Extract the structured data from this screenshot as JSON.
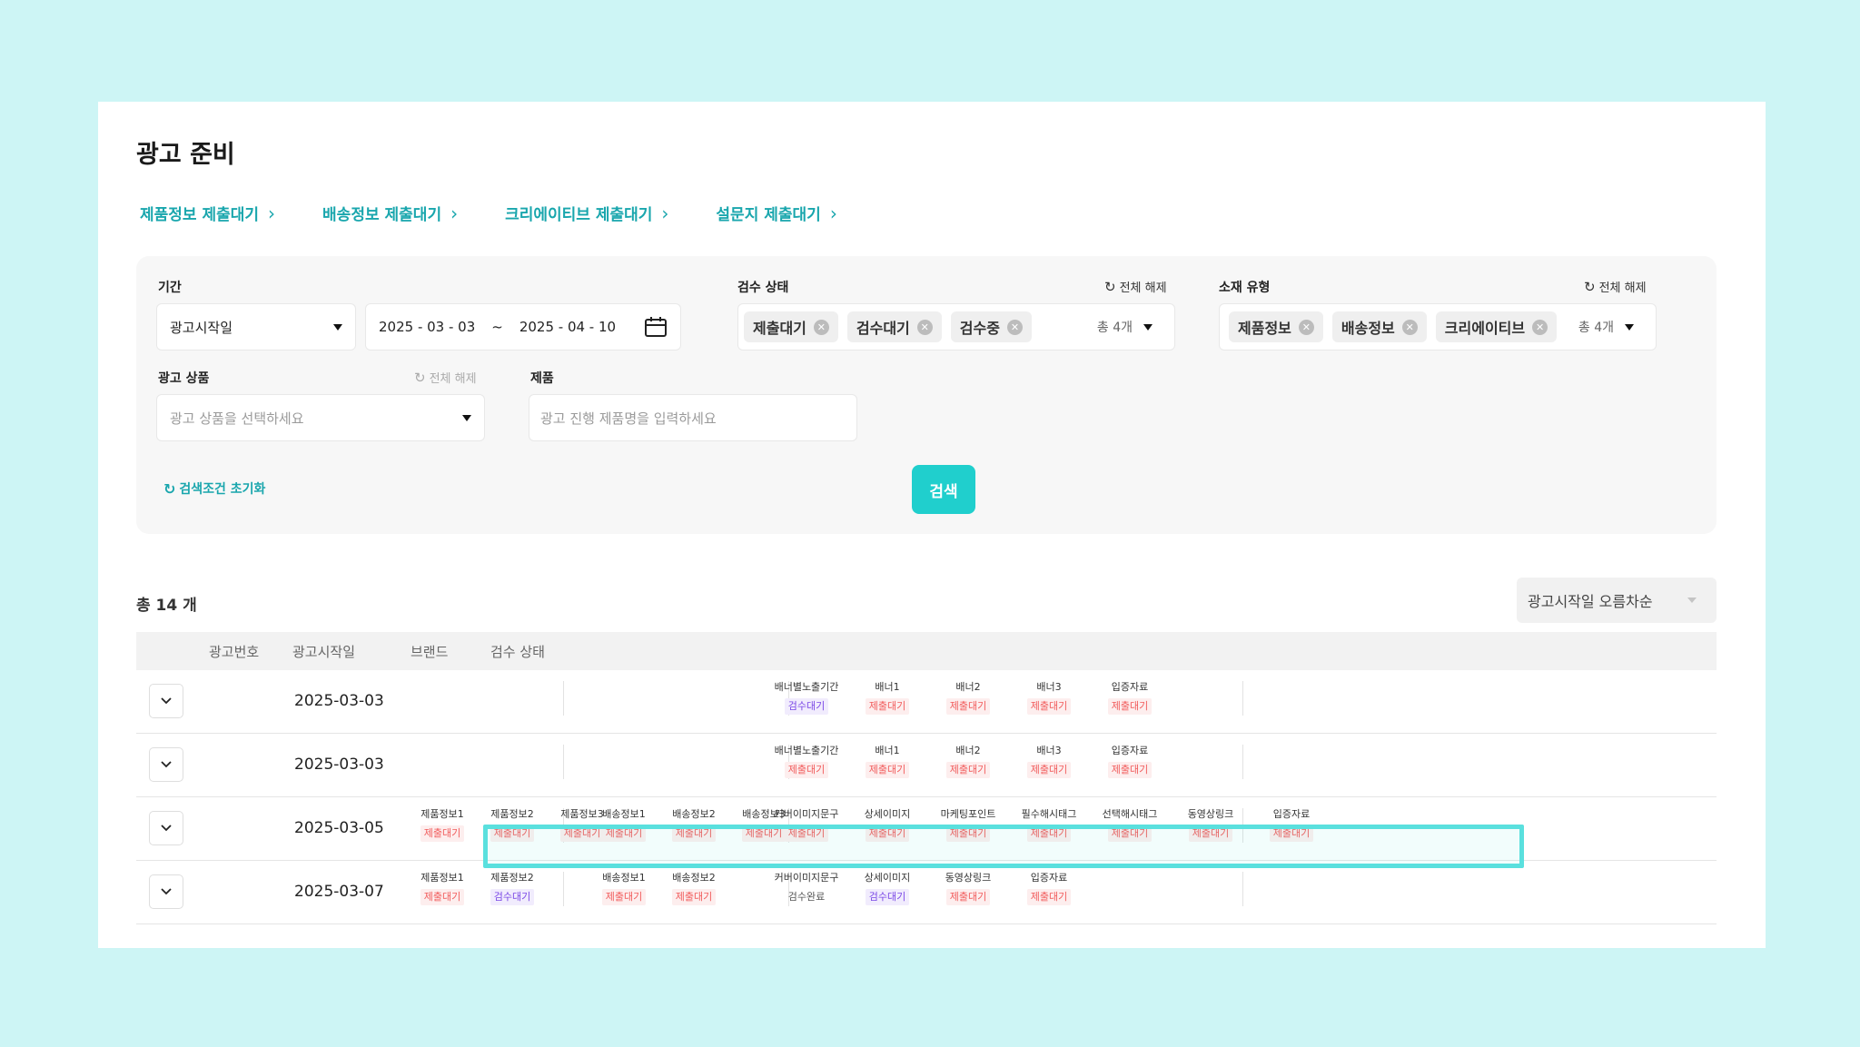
{
  "page": {
    "title": "광고 준비",
    "quick_links": [
      "제품정보 제출대기",
      "배송정보 제출대기",
      "크리에이티브 제출대기",
      "설문지 제출대기"
    ],
    "chevron": "›"
  },
  "filters": {
    "period": {
      "label": "기간",
      "type_value": "광고시작일",
      "start_date": "2025 - 03 - 03",
      "tilde": "~",
      "end_date": "2025 - 04 - 10"
    },
    "review_status": {
      "label": "검수 상태",
      "clear_label": "전체 해제",
      "chips": [
        "제출대기",
        "검수대기",
        "검수중"
      ],
      "count": "총 4개"
    },
    "material_type": {
      "label": "소재 유형",
      "clear_label": "전체 해제",
      "chips": [
        "제품정보",
        "배송정보",
        "크리에이티브"
      ],
      "count": "총 4개"
    },
    "ad_product": {
      "label": "광고 상품",
      "clear_label": "전체 해제",
      "placeholder": "광고 상품을 선택하세요"
    },
    "product": {
      "label": "제품",
      "placeholder": "광고 진행 제품명을 입력하세요"
    },
    "reset_label": "검색조건 초기화",
    "search_label": "검색"
  },
  "list": {
    "total": "총 14 개",
    "sort_value": "광고시작일 오름차순",
    "headers": [
      "광고번호",
      "광고시작일",
      "브랜드",
      "검수 상태"
    ],
    "rows": [
      {
        "date": "2025-03-03",
        "groups": [
          [],
          [],
          [
            {
              "name": "배너별노출기간",
              "status": "검수대기",
              "tone": "purple"
            },
            {
              "name": "배너1",
              "status": "제출대기",
              "tone": "red"
            },
            {
              "name": "배너2",
              "status": "제출대기",
              "tone": "red"
            },
            {
              "name": "배너3",
              "status": "제출대기",
              "tone": "red"
            },
            {
              "name": "입증자료",
              "status": "제출대기",
              "tone": "red"
            }
          ]
        ]
      },
      {
        "date": "2025-03-03",
        "groups": [
          [],
          [],
          [
            {
              "name": "배너별노출기간",
              "status": "제출대기",
              "tone": "red"
            },
            {
              "name": "배너1",
              "status": "제출대기",
              "tone": "red"
            },
            {
              "name": "배너2",
              "status": "제출대기",
              "tone": "red"
            },
            {
              "name": "배너3",
              "status": "제출대기",
              "tone": "red"
            },
            {
              "name": "입증자료",
              "status": "제출대기",
              "tone": "red"
            }
          ]
        ]
      },
      {
        "date": "2025-03-05",
        "groups": [
          [
            {
              "name": "제품정보1",
              "status": "제출대기",
              "tone": "red"
            },
            {
              "name": "제품정보2",
              "status": "제출대기",
              "tone": "red"
            },
            {
              "name": "제품정보3",
              "status": "제출대기",
              "tone": "red"
            }
          ],
          [
            {
              "name": "배송정보1",
              "status": "제출대기",
              "tone": "red"
            },
            {
              "name": "배송정보2",
              "status": "제출대기",
              "tone": "red"
            },
            {
              "name": "배송정보3",
              "status": "제출대기",
              "tone": "red"
            }
          ],
          [
            {
              "name": "커버이미지문구",
              "status": "제출대기",
              "tone": "red"
            },
            {
              "name": "상세이미지",
              "status": "제출대기",
              "tone": "red"
            },
            {
              "name": "마케팅포인트",
              "status": "제출대기",
              "tone": "red"
            },
            {
              "name": "필수해시태그",
              "status": "제출대기",
              "tone": "red"
            },
            {
              "name": "선택해시태그",
              "status": "제출대기",
              "tone": "red"
            },
            {
              "name": "동영상링크",
              "status": "제출대기",
              "tone": "red"
            },
            {
              "name": "입증자료",
              "status": "제출대기",
              "tone": "red"
            }
          ]
        ]
      },
      {
        "date": "2025-03-07",
        "groups": [
          [
            {
              "name": "제품정보1",
              "status": "제출대기",
              "tone": "red"
            },
            {
              "name": "제품정보2",
              "status": "검수대기",
              "tone": "purple"
            }
          ],
          [
            {
              "name": "배송정보1",
              "status": "제출대기",
              "tone": "red"
            },
            {
              "name": "배송정보2",
              "status": "제출대기",
              "tone": "red"
            }
          ],
          [
            {
              "name": "커버이미지문구",
              "status": "검수완료",
              "tone": "gray"
            },
            {
              "name": "상세이미지",
              "status": "검수대기",
              "tone": "purple"
            },
            {
              "name": "동영상링크",
              "status": "제출대기",
              "tone": "red"
            },
            {
              "name": "입증자료",
              "status": "제출대기",
              "tone": "red"
            }
          ]
        ]
      }
    ]
  },
  "colors": {
    "accent": "#19a6ad",
    "search_button": "#20cfcd",
    "highlight": "#5ae0de",
    "status_red": "#f15a5a",
    "status_purple": "#7a47e6"
  },
  "icons": [
    "chevron-right-icon",
    "refresh-icon",
    "calendar-icon",
    "remove-chip-icon",
    "dropdown-triangle-icon",
    "chevron-down-icon"
  ]
}
